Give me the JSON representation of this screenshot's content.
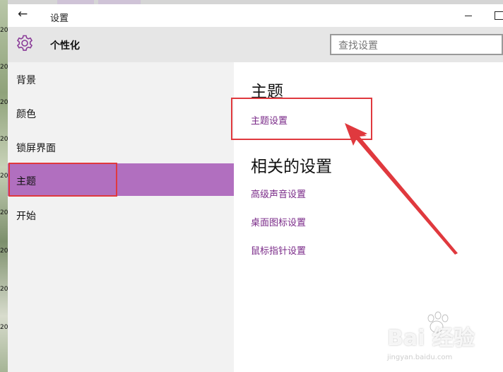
{
  "window": {
    "back_glyph": "←",
    "title": "设置"
  },
  "header": {
    "icon": "gear-icon",
    "title": "个性化",
    "search_placeholder": "查找设置"
  },
  "sidebar": {
    "items": [
      {
        "label": "背景"
      },
      {
        "label": "颜色"
      },
      {
        "label": "锁屏界面"
      },
      {
        "label": "主题",
        "selected": true
      },
      {
        "label": "开始"
      }
    ]
  },
  "main": {
    "theme_section": {
      "title": "主题",
      "link": "主题设置"
    },
    "related_section": {
      "title": "相关的设置",
      "links": [
        "高级声音设置",
        "桌面图标设置",
        "鼠标指针设置"
      ]
    }
  },
  "desktop_labels": [
    "20",
    "20",
    "20",
    "20",
    "20",
    "20",
    "20",
    "20",
    "20"
  ],
  "watermark": {
    "text": "Bai 经验",
    "sub": "jingyan.baidu.com"
  },
  "colors": {
    "accent": "#b16fbf",
    "link": "#7a2a88",
    "annotation": "#e0393e",
    "header_bg": "#e6e6e6",
    "sidebar_bg": "#f2f2f2"
  }
}
